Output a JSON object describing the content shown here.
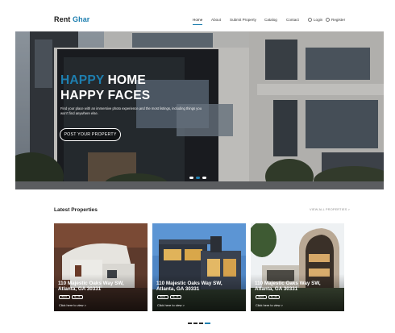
{
  "header": {
    "logo_part1": "Rent ",
    "logo_part2": "Ghar",
    "nav": [
      {
        "label": "Home",
        "active": true
      },
      {
        "label": "About"
      },
      {
        "label": "Submit Property"
      },
      {
        "label": "Catalog"
      },
      {
        "label": "Contact"
      }
    ],
    "login_label": "Login",
    "register_label": "Register"
  },
  "hero": {
    "title_highlight": "HAPPY",
    "title_rest": " HOME",
    "title_line2": "HAPPY FACES",
    "subtitle": "Find your place with an immersive photo experience,and the most listings, including things you won't find anywhere else.",
    "cta_label": "POST YOUR PROPERTY",
    "slide_count": 3,
    "active_slide": 2
  },
  "latest": {
    "title": "Latest Properties",
    "view_all": "VIEW ALL PROPERTIES >",
    "cards": [
      {
        "address_line1": "110 Majestic Oaks Way SW,",
        "address_line2": "Atlanta, GA 30331",
        "badge1": "BHK1",
        "badge2": "6k, 2ft",
        "link": "Click here to view >"
      },
      {
        "address_line1": "110 Majestic Oaks Way SW,",
        "address_line2": "Atlanta, GA 30331",
        "badge1": "BHK1",
        "badge2": "6k, 2ft",
        "link": "Click here to view >"
      },
      {
        "address_line1": "110 Majestic Oaks Way SW,",
        "address_line2": "Atlanta, GA 30331",
        "badge1": "BHK1",
        "badge2": "6k, 2ft",
        "link": "Click here to view >"
      }
    ]
  },
  "colors": {
    "accent": "#1e7fb0",
    "text_dark": "#222222"
  },
  "icons": {
    "login": "user-icon",
    "register": "user-plus-icon"
  }
}
